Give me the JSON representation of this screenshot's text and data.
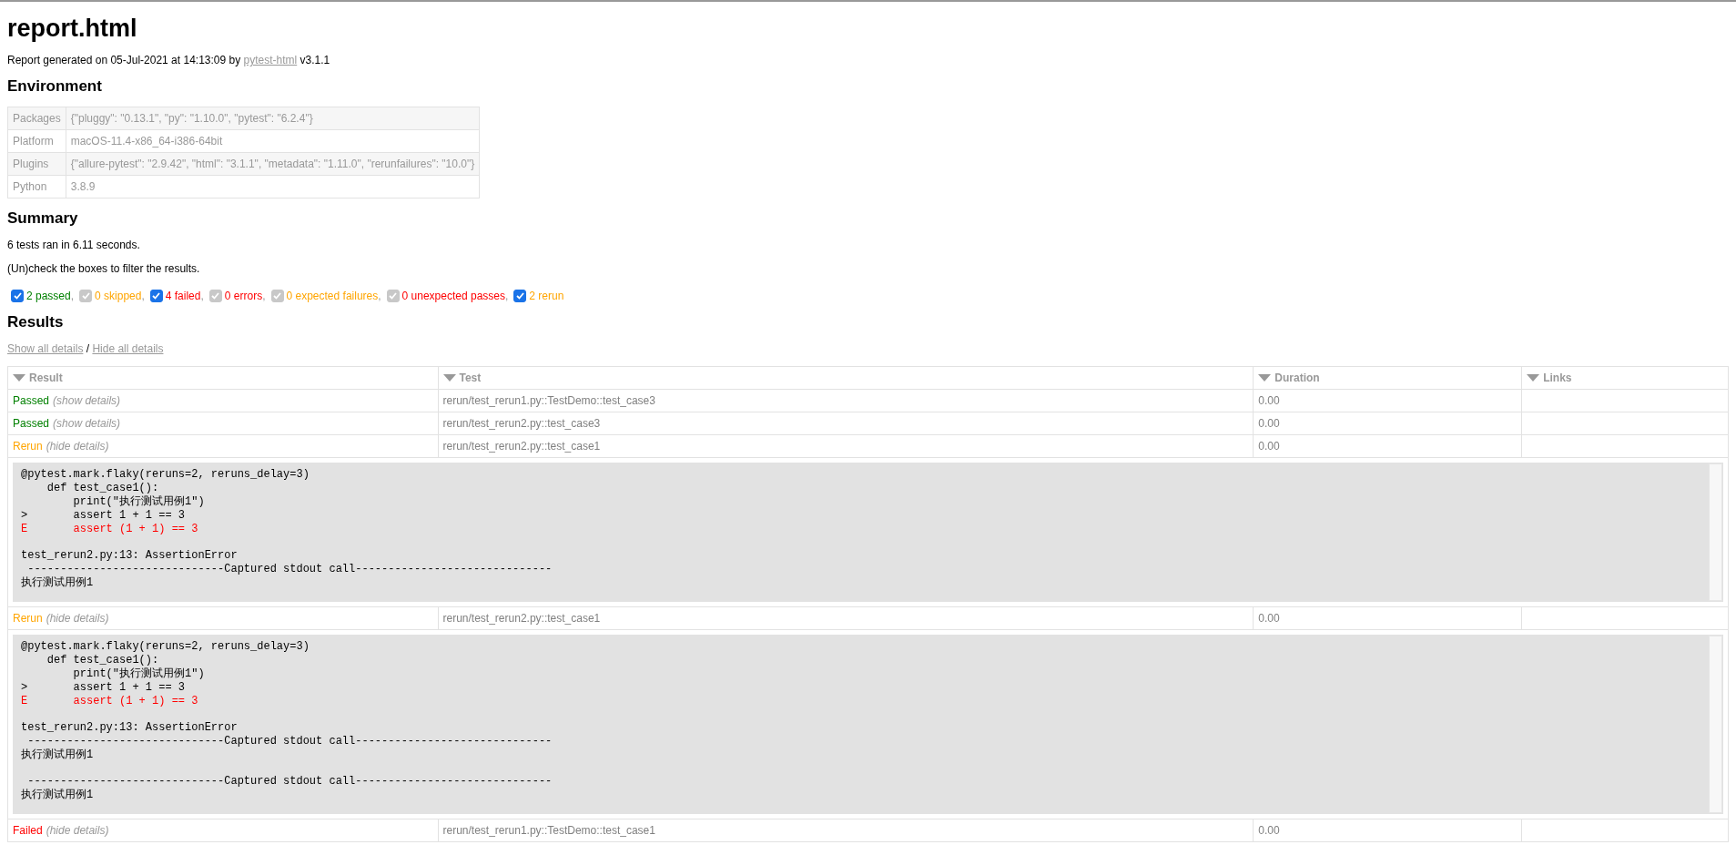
{
  "title": "report.html",
  "generated": {
    "prefix": "Report generated on 05-Jul-2021 at 14:13:09 by ",
    "link": "pytest-html",
    "suffix": " v3.1.1"
  },
  "environment": {
    "heading": "Environment",
    "rows": [
      {
        "key": "Packages",
        "value": "{\"pluggy\": \"0.13.1\", \"py\": \"1.10.0\", \"pytest\": \"6.2.4\"}"
      },
      {
        "key": "Platform",
        "value": "macOS-11.4-x86_64-i386-64bit"
      },
      {
        "key": "Plugins",
        "value": "{\"allure-pytest\": \"2.9.42\", \"html\": \"3.1.1\", \"metadata\": \"1.11.0\", \"rerunfailures\": \"10.0\"}"
      },
      {
        "key": "Python",
        "value": "3.8.9"
      }
    ]
  },
  "summary": {
    "heading": "Summary",
    "ran": "6 tests ran in 6.11 seconds.",
    "hint": "(Un)check the boxes to filter the results.",
    "filters": [
      {
        "label": "2 passed",
        "kind": "passed",
        "checked": true,
        "disabled": false,
        "separator": ","
      },
      {
        "label": "0 skipped",
        "kind": "skipped",
        "checked": true,
        "disabled": true,
        "separator": ","
      },
      {
        "label": "4 failed",
        "kind": "failed",
        "checked": true,
        "disabled": false,
        "separator": ","
      },
      {
        "label": "0 errors",
        "kind": "error",
        "checked": true,
        "disabled": true,
        "separator": ","
      },
      {
        "label": "0 expected failures",
        "kind": "xfailed",
        "checked": true,
        "disabled": true,
        "separator": ","
      },
      {
        "label": "0 unexpected passes",
        "kind": "xpassed",
        "checked": true,
        "disabled": true,
        "separator": ","
      },
      {
        "label": "2 rerun",
        "kind": "rerun",
        "checked": true,
        "disabled": false
      }
    ]
  },
  "results": {
    "heading": "Results",
    "show_all": "Show all details",
    "separator": "/",
    "hide_all": "Hide all details",
    "columns": [
      "Result",
      "Test",
      "Duration",
      "Links"
    ],
    "rows": [
      {
        "kind": "passed",
        "result": "Passed",
        "toggle": "(show details)",
        "test": "rerun/test_rerun1.py::TestDemo::test_case3",
        "duration": "0.00"
      },
      {
        "kind": "passed",
        "result": "Passed",
        "toggle": "(show details)",
        "test": "rerun/test_rerun2.py::test_case3",
        "duration": "0.00"
      },
      {
        "kind": "rerun",
        "result": "Rerun",
        "toggle": "(hide details)",
        "test": "rerun/test_rerun2.py::test_case1",
        "duration": "0.00",
        "log": [
          {
            "lines": [
              {
                "text": "@pytest.mark.flaky(reruns=2, reruns_delay=3)",
                "kind": "source"
              },
              {
                "text": "    def test_case1():",
                "kind": "source"
              },
              {
                "text": "        print(\"执行测试用例1\")",
                "kind": "source"
              },
              {
                "text": ">       assert 1 + 1 == 3",
                "kind": "source"
              },
              {
                "text": "E       assert (1 + 1) == 3",
                "kind": "error"
              }
            ]
          },
          {
            "lines": [
              {
                "text": "test_rerun2.py:13: AssertionError",
                "kind": "source"
              },
              {
                "text": " ------------------------------Captured stdout call------------------------------",
                "kind": "source"
              },
              {
                "text": "执行测试用例1",
                "kind": "source"
              }
            ]
          }
        ]
      },
      {
        "kind": "rerun",
        "result": "Rerun",
        "toggle": "(hide details)",
        "test": "rerun/test_rerun2.py::test_case1",
        "duration": "0.00",
        "log": [
          {
            "lines": [
              {
                "text": "@pytest.mark.flaky(reruns=2, reruns_delay=3)",
                "kind": "source"
              },
              {
                "text": "    def test_case1():",
                "kind": "source"
              },
              {
                "text": "        print(\"执行测试用例1\")",
                "kind": "source"
              },
              {
                "text": ">       assert 1 + 1 == 3",
                "kind": "source"
              },
              {
                "text": "E       assert (1 + 1) == 3",
                "kind": "error"
              }
            ]
          },
          {
            "lines": [
              {
                "text": "test_rerun2.py:13: AssertionError",
                "kind": "source"
              },
              {
                "text": " ------------------------------Captured stdout call------------------------------",
                "kind": "source"
              },
              {
                "text": "执行测试用例1",
                "kind": "source"
              }
            ]
          },
          {
            "lines": [
              {
                "text": " ------------------------------Captured stdout call------------------------------",
                "kind": "source"
              },
              {
                "text": "执行测试用例1",
                "kind": "source"
              }
            ]
          }
        ]
      },
      {
        "kind": "failed",
        "result": "Failed",
        "toggle": "(hide details)",
        "test": "rerun/test_rerun1.py::TestDemo::test_case1",
        "duration": "0.00"
      }
    ]
  }
}
